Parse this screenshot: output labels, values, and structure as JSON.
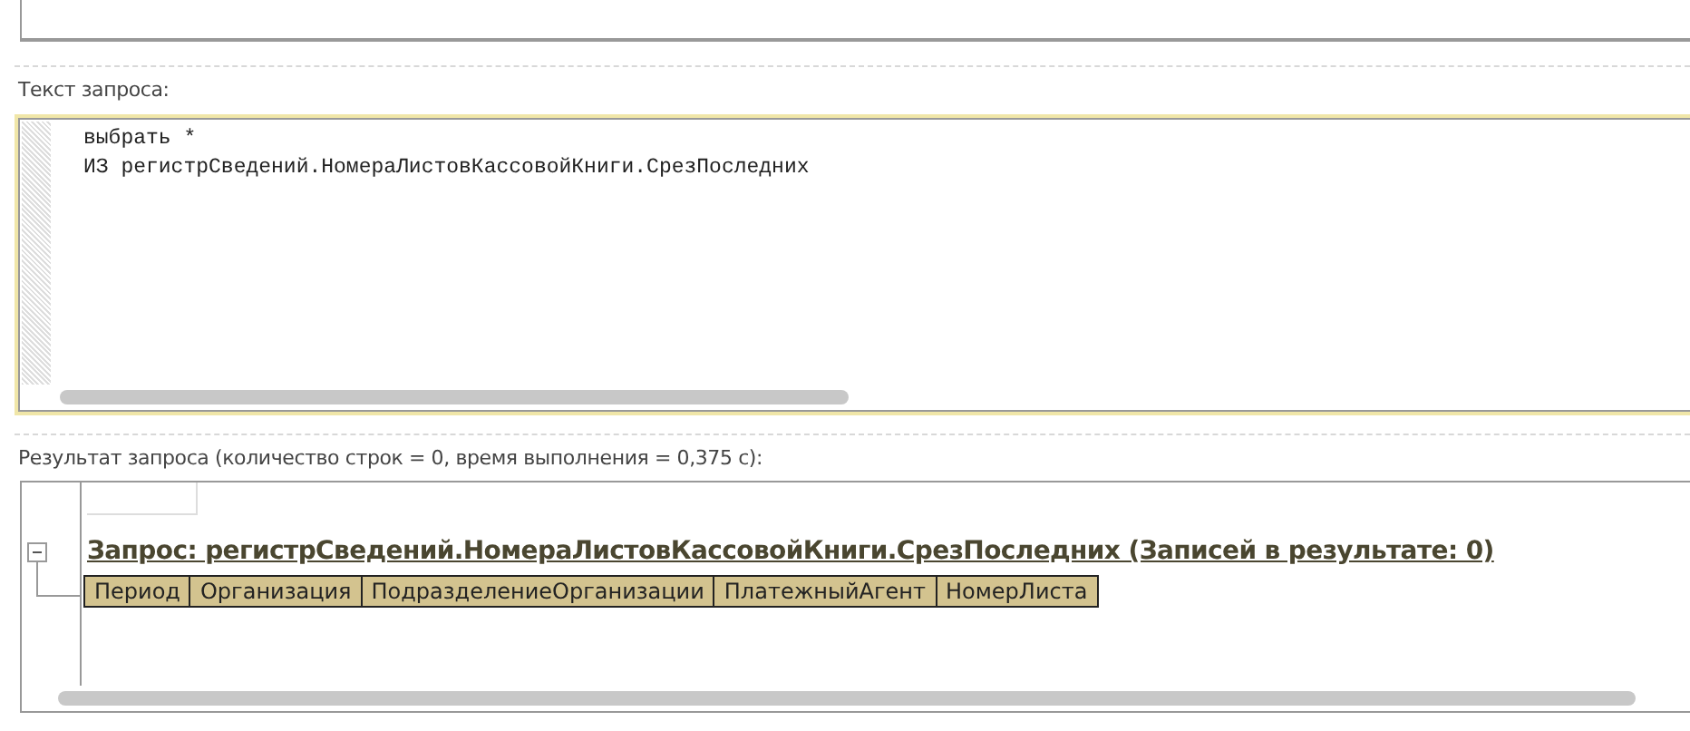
{
  "query_label": "Текст запроса:",
  "query_lines": [
    "выбрать *",
    "ИЗ регистрСведений.НомераЛистовКассовойКниги.СрезПоследних"
  ],
  "result_label": "Результат запроса (количество строк = 0, время выполнения = 0,375 с):",
  "result": {
    "expanded": true,
    "title": "Запрос: регистрСведений.НомераЛистовКассовойКниги.СрезПоследних (Записей в результате: 0)",
    "columns": [
      "Период",
      "Организация",
      "ПодразделениеОрганизации",
      "ПлатежныйАгент",
      "НомерЛиста"
    ]
  }
}
